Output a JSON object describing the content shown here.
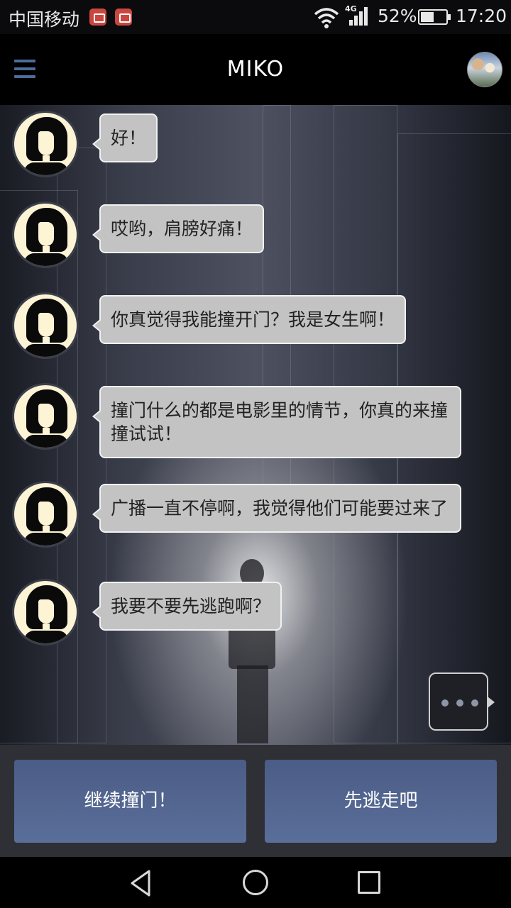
{
  "status_bar": {
    "carrier": "中国移动",
    "network": "4G",
    "battery": "52%",
    "battery_level": 0.52,
    "time": "17:20",
    "icons": [
      "notification-icon",
      "notification-icon",
      "wifi-icon",
      "signal-icon",
      "battery-icon"
    ]
  },
  "header": {
    "title": "MIKO",
    "menu_icon": "hamburger-menu-icon",
    "avatar_icon": "user-avatar"
  },
  "messages": [
    {
      "text": "好！"
    },
    {
      "text": "哎哟，肩膀好痛！"
    },
    {
      "text": "你真觉得我能撞开门？我是女生啊！"
    },
    {
      "text": "撞门什么的都是电影里的情节，你真的来撞撞试试！"
    },
    {
      "text": "广播一直不停啊，我觉得他们可能要过来了"
    },
    {
      "text": "我要不要先逃跑啊？"
    }
  ],
  "typing_indicator": "typing-dots-icon",
  "choices": [
    {
      "label": "继续撞门！"
    },
    {
      "label": "先逃走吧"
    }
  ],
  "nav": {
    "back": "back-icon",
    "home": "home-icon",
    "recents": "recents-icon"
  },
  "colors": {
    "choice_button": "#5a6e9a",
    "bubble": "#c3c3c3",
    "menu_icon": "#4f6b9a"
  }
}
